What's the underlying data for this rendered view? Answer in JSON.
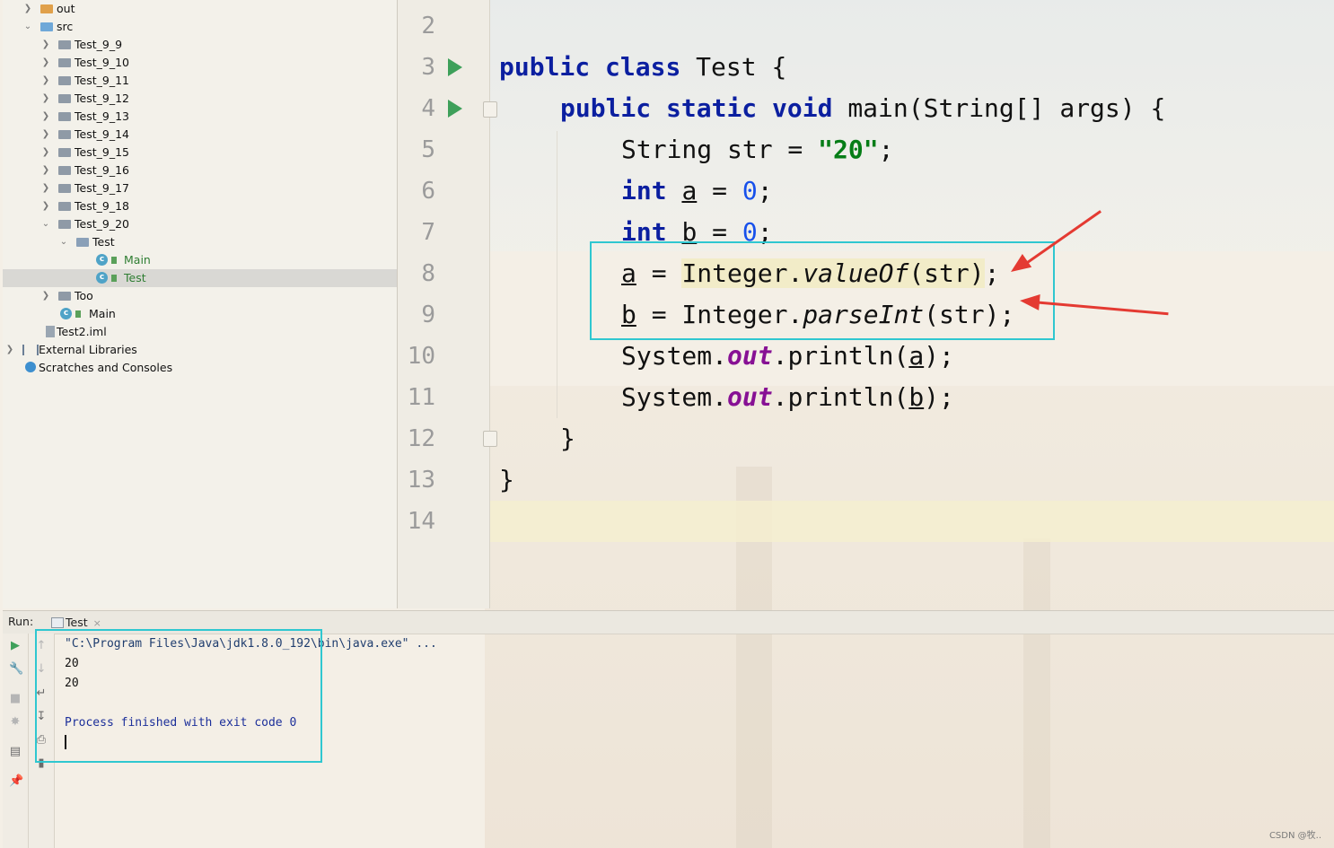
{
  "project_tree": {
    "items": [
      {
        "label": "out",
        "icon": "folder-orange-icon",
        "expanded": false,
        "selected": false
      },
      {
        "label": "src",
        "icon": "folder-blue-icon",
        "expanded": true,
        "selected": false
      },
      {
        "label": "Test_9_9",
        "icon": "package-folder-icon",
        "expanded": false,
        "selected": false
      },
      {
        "label": "Test_9_10",
        "icon": "package-folder-icon",
        "expanded": false,
        "selected": false
      },
      {
        "label": "Test_9_11",
        "icon": "package-folder-icon",
        "expanded": false,
        "selected": false
      },
      {
        "label": "Test_9_12",
        "icon": "package-folder-icon",
        "expanded": false,
        "selected": false
      },
      {
        "label": "Test_9_13",
        "icon": "package-folder-icon",
        "expanded": false,
        "selected": false
      },
      {
        "label": "Test_9_14",
        "icon": "package-folder-icon",
        "expanded": false,
        "selected": false
      },
      {
        "label": "Test_9_15",
        "icon": "package-folder-icon",
        "expanded": false,
        "selected": false
      },
      {
        "label": "Test_9_16",
        "icon": "package-folder-icon",
        "expanded": false,
        "selected": false
      },
      {
        "label": "Test_9_17",
        "icon": "package-folder-icon",
        "expanded": false,
        "selected": false
      },
      {
        "label": "Test_9_18",
        "icon": "package-folder-icon",
        "expanded": false,
        "selected": false
      },
      {
        "label": "Test_9_20",
        "icon": "package-folder-icon",
        "expanded": true,
        "selected": false
      },
      {
        "label": "Test",
        "icon": "package-folder-icon",
        "expanded": true,
        "selected": false
      },
      {
        "label": "Main",
        "icon": "java-class-icon",
        "expanded": null,
        "selected": false
      },
      {
        "label": "Test",
        "icon": "java-class-icon",
        "expanded": null,
        "selected": true
      },
      {
        "label": "Too",
        "icon": "package-folder-icon",
        "expanded": false,
        "selected": false
      },
      {
        "label": "Main",
        "icon": "java-class-icon",
        "expanded": null,
        "selected": false
      },
      {
        "label": "Test2.iml",
        "icon": "module-file-icon",
        "expanded": null,
        "selected": false
      },
      {
        "label": "External Libraries",
        "icon": "libraries-icon",
        "expanded": false,
        "selected": false
      },
      {
        "label": "Scratches and Consoles",
        "icon": "scratches-icon",
        "expanded": null,
        "selected": false
      }
    ]
  },
  "editor": {
    "line_numbers": [
      "2",
      "3",
      "4",
      "5",
      "6",
      "7",
      "8",
      "9",
      "10",
      "11",
      "12",
      "13",
      "14"
    ],
    "code": {
      "l3": [
        "public",
        "class",
        "Test {"
      ],
      "l4": [
        "public",
        "static",
        "void",
        "main(String[] args) {"
      ],
      "l5": [
        "String str = ",
        "\"20\"",
        ";"
      ],
      "l6": [
        "int",
        "a",
        " = ",
        "0",
        ";"
      ],
      "l7": [
        "int",
        "b",
        " = ",
        "0",
        ";"
      ],
      "l8": [
        "a",
        " = ",
        "Integer.",
        "valueOf",
        "(str)",
        ";"
      ],
      "l9": [
        "b",
        " = Integer.",
        "parseInt",
        "(str);"
      ],
      "l10": [
        "System.",
        "out",
        ".println(",
        "a",
        ");"
      ],
      "l11": [
        "System.",
        "out",
        ".println(",
        "b",
        ");"
      ],
      "l12": [
        "}"
      ],
      "l13": [
        "}"
      ]
    }
  },
  "run_panel": {
    "label": "Run:",
    "tab": "Test",
    "tab_close": "×",
    "output": [
      "\"C:\\Program Files\\Java\\jdk1.8.0_192\\bin\\java.exe\" ...",
      "20",
      "20",
      "",
      "Process finished with exit code 0"
    ]
  },
  "watermark": "CSDN @牧..",
  "colors": {
    "highlight_box": "#2fc7d0",
    "arrow": "#e43a32",
    "keyword": "#0b1fa0",
    "string": "#067d17",
    "number": "#1750eb",
    "static_field": "#871094"
  }
}
